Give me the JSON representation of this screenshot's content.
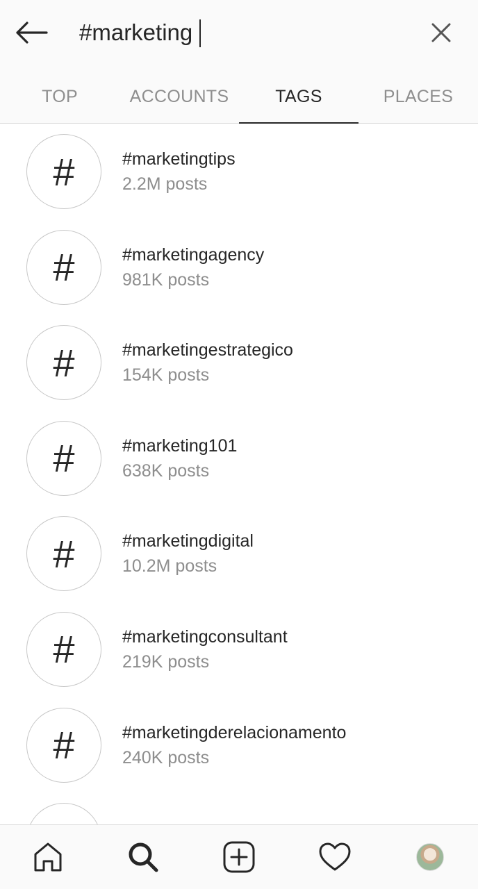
{
  "search": {
    "query": "#marketing"
  },
  "tabs": [
    {
      "label": "TOP",
      "active": false
    },
    {
      "label": "ACCOUNTS",
      "active": false
    },
    {
      "label": "TAGS",
      "active": true
    },
    {
      "label": "PLACES",
      "active": false
    }
  ],
  "results": [
    {
      "symbol": "#",
      "tag": "#marketingtips",
      "count": "2.2M posts"
    },
    {
      "symbol": "#",
      "tag": "#marketingagency",
      "count": "981K posts"
    },
    {
      "symbol": "#",
      "tag": "#marketingestrategico",
      "count": "154K posts"
    },
    {
      "symbol": "#",
      "tag": "#marketing101",
      "count": "638K posts"
    },
    {
      "symbol": "#",
      "tag": "#marketingdigital",
      "count": "10.2M posts"
    },
    {
      "symbol": "#",
      "tag": "#marketingconsultant",
      "count": "219K posts"
    },
    {
      "symbol": "#",
      "tag": "#marketingderelacionamento",
      "count": "240K posts"
    },
    {
      "symbol": "#",
      "tag": "",
      "count": ""
    }
  ],
  "bottom_nav": [
    {
      "icon": "home-icon"
    },
    {
      "icon": "search-icon",
      "active": true
    },
    {
      "icon": "add-post-icon"
    },
    {
      "icon": "heart-icon"
    },
    {
      "icon": "profile-avatar"
    }
  ],
  "colors": {
    "text_primary": "#262626",
    "text_secondary": "#8e8e8e",
    "divider": "#dbdbdb",
    "bar_background": "#fafafa"
  }
}
